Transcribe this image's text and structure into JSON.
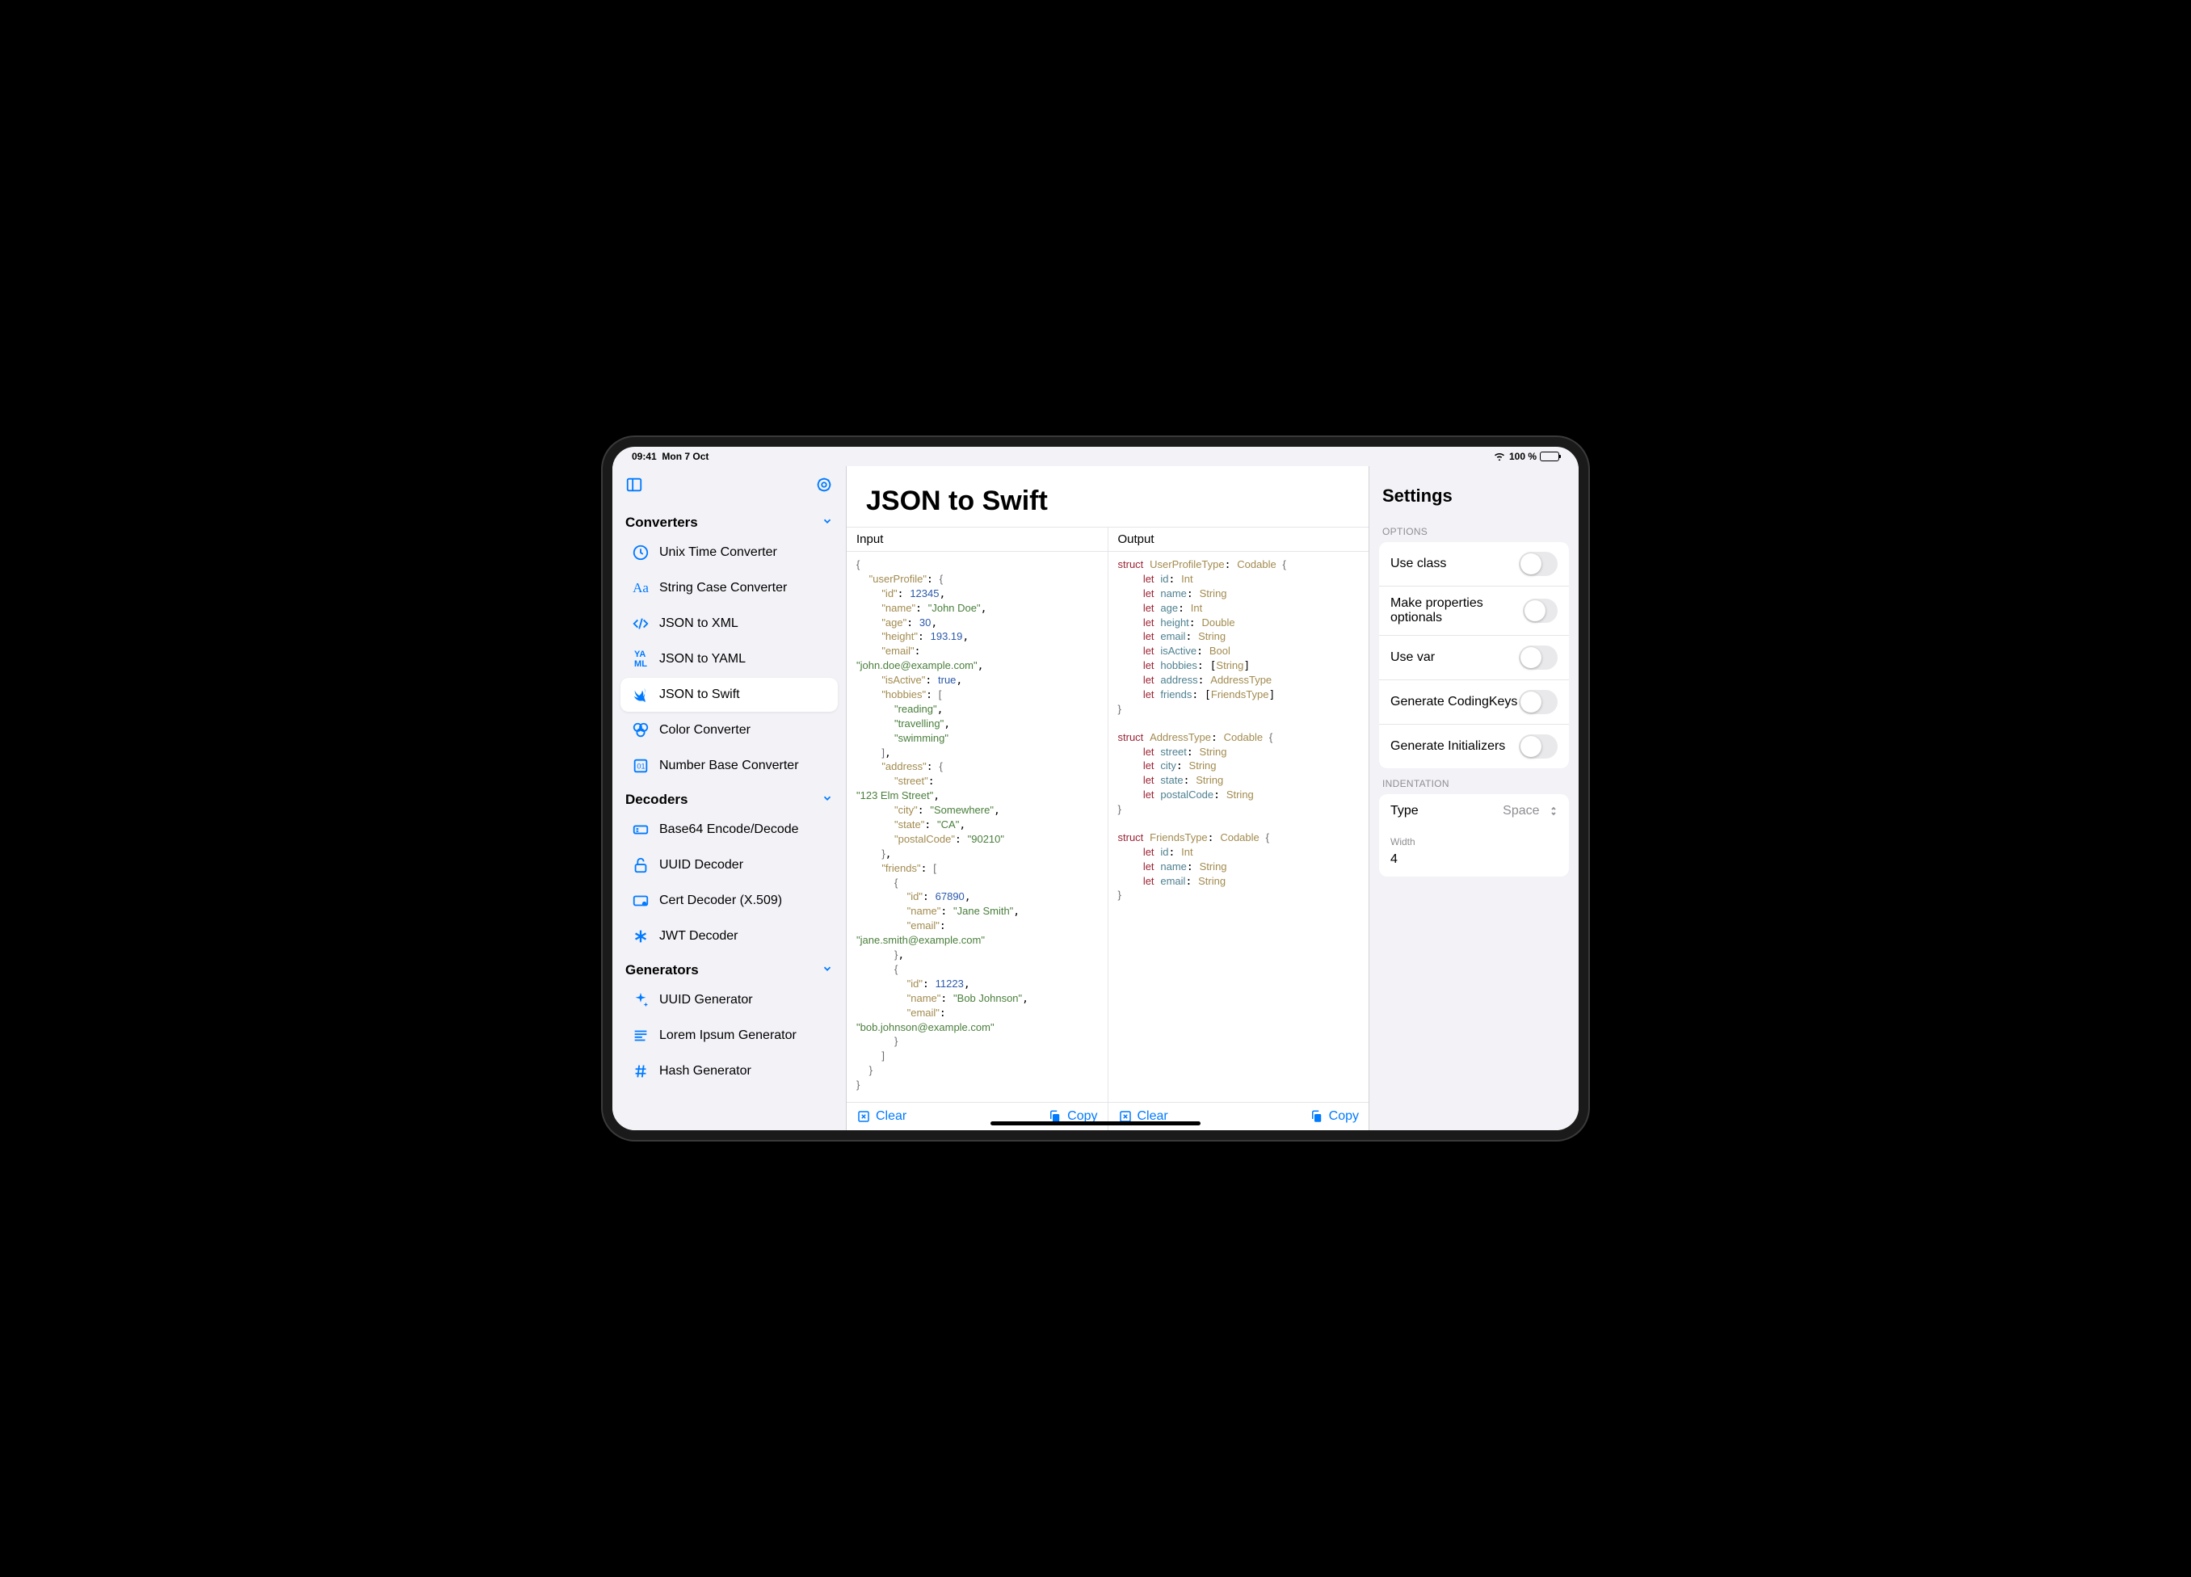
{
  "statusbar": {
    "time": "09:41",
    "date": "Mon 7 Oct",
    "battery": "100 %"
  },
  "sidebar": {
    "sections": [
      {
        "title": "Converters",
        "items": [
          {
            "label": "Unix Time Converter",
            "icon": "clock"
          },
          {
            "label": "String Case Converter",
            "icon": "text"
          },
          {
            "label": "JSON to XML",
            "icon": "code"
          },
          {
            "label": "JSON to YAML",
            "icon": "yaml"
          },
          {
            "label": "JSON to Swift",
            "icon": "swift",
            "selected": true
          },
          {
            "label": "Color Converter",
            "icon": "palette"
          },
          {
            "label": "Number Base Converter",
            "icon": "binary"
          }
        ]
      },
      {
        "title": "Decoders",
        "items": [
          {
            "label": "Base64 Encode/Decode",
            "icon": "b64"
          },
          {
            "label": "UUID Decoder",
            "icon": "lockopen"
          },
          {
            "label": "Cert Decoder (X.509)",
            "icon": "cert"
          },
          {
            "label": "JWT Decoder",
            "icon": "asterisk"
          }
        ]
      },
      {
        "title": "Generators",
        "items": [
          {
            "label": "UUID Generator",
            "icon": "sparkle"
          },
          {
            "label": "Lorem Ipsum Generator",
            "icon": "lines"
          },
          {
            "label": "Hash Generator",
            "icon": "hash"
          }
        ]
      }
    ]
  },
  "main": {
    "title": "JSON to Swift",
    "input_label": "Input",
    "output_label": "Output",
    "clear": "Clear",
    "copy": "Copy",
    "input_json": {
      "userProfile": {
        "id": 12345,
        "name": "John Doe",
        "age": 30,
        "height": 193.19,
        "email": "john.doe@example.com",
        "isActive": true,
        "hobbies": [
          "reading",
          "travelling",
          "swimming"
        ],
        "address": {
          "street": "123 Elm Street",
          "city": "Somewhere",
          "state": "CA",
          "postalCode": "90210"
        },
        "friends": [
          {
            "id": 67890,
            "name": "Jane Smith",
            "email": "jane.smith@example.com"
          },
          {
            "id": 11223,
            "name": "Bob Johnson",
            "email": "bob.johnson@example.com"
          }
        ]
      }
    },
    "output_swift": [
      {
        "struct": "UserProfileType",
        "protocol": "Codable",
        "props": [
          [
            "id",
            "Int"
          ],
          [
            "name",
            "String"
          ],
          [
            "age",
            "Int"
          ],
          [
            "height",
            "Double"
          ],
          [
            "email",
            "String"
          ],
          [
            "isActive",
            "Bool"
          ],
          [
            "hobbies",
            "[String]"
          ],
          [
            "address",
            "AddressType"
          ],
          [
            "friends",
            "[FriendsType]"
          ]
        ]
      },
      {
        "struct": "AddressType",
        "protocol": "Codable",
        "props": [
          [
            "street",
            "String"
          ],
          [
            "city",
            "String"
          ],
          [
            "state",
            "String"
          ],
          [
            "postalCode",
            "String"
          ]
        ]
      },
      {
        "struct": "FriendsType",
        "protocol": "Codable",
        "props": [
          [
            "id",
            "Int"
          ],
          [
            "name",
            "String"
          ],
          [
            "email",
            "String"
          ]
        ]
      }
    ]
  },
  "settings": {
    "title": "Settings",
    "options_label": "OPTIONS",
    "options": [
      {
        "label": "Use class",
        "on": false
      },
      {
        "label": "Make properties optionals",
        "on": false
      },
      {
        "label": "Use var",
        "on": false
      },
      {
        "label": "Generate CodingKeys",
        "on": false
      },
      {
        "label": "Generate Initializers",
        "on": false
      }
    ],
    "indent_label": "INDENTATION",
    "type_label": "Type",
    "type_value": "Space",
    "width_label": "Width",
    "width_value": "4"
  }
}
